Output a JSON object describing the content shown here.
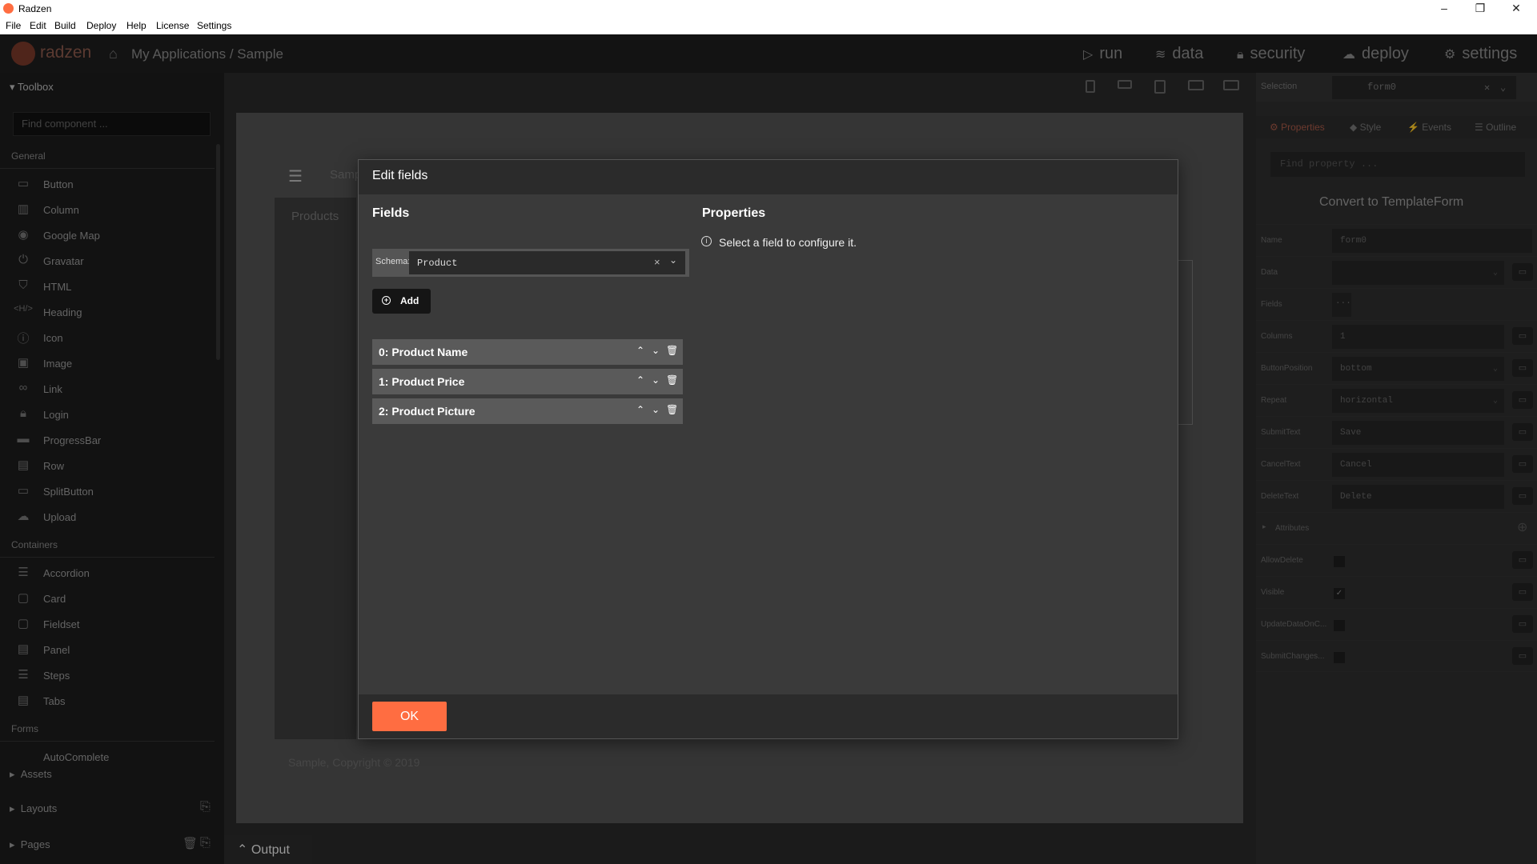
{
  "window": {
    "title": "Radzen",
    "min": "–",
    "max": "❐",
    "close": "✕"
  },
  "menu": [
    "File",
    "Edit",
    "Build",
    "Deploy",
    "Help",
    "License",
    "Settings"
  ],
  "header": {
    "brand": "radzen",
    "breadcrumb": "My Applications / Sample",
    "nav": [
      {
        "icon": "play-icon",
        "label": "run"
      },
      {
        "icon": "layers-icon",
        "label": "data"
      },
      {
        "icon": "lock-icon",
        "label": "security"
      },
      {
        "icon": "cloud-upload-icon",
        "label": "deploy"
      },
      {
        "icon": "gear-icon",
        "label": "settings"
      }
    ]
  },
  "toolbox": {
    "title": "Toolbox",
    "search_placeholder": "Find component ...",
    "general_label": "General",
    "general": [
      "Button",
      "Column",
      "Google Map",
      "Gravatar",
      "HTML",
      "Heading",
      "Icon",
      "Image",
      "Link",
      "Login",
      "ProgressBar",
      "Row",
      "SplitButton",
      "Upload"
    ],
    "containers_label": "Containers",
    "containers": [
      "Accordion",
      "Card",
      "Fieldset",
      "Panel",
      "Steps",
      "Tabs"
    ],
    "forms_label": "Forms",
    "forms_partial": "AutoComplete",
    "assets": "Assets",
    "layouts": "Layouts",
    "pages": "Pages"
  },
  "canvas": {
    "page_title": "Samp",
    "nav_item": "Products",
    "footer": "Sample, Copyright © 2019"
  },
  "props": {
    "selection_label": "Selection",
    "selection_value": "form0",
    "tabs": [
      "Properties",
      "Style",
      "Events",
      "Outline"
    ],
    "find_placeholder": "Find property ...",
    "convert": "Convert to TemplateForm",
    "rows": [
      {
        "label": "Name",
        "value": "form0"
      },
      {
        "label": "Data",
        "value": ""
      },
      {
        "label": "Fields",
        "value": "..."
      },
      {
        "label": "Columns",
        "value": "1"
      },
      {
        "label": "ButtonPosition",
        "value": "bottom"
      },
      {
        "label": "Repeat",
        "value": "horizontal"
      },
      {
        "label": "SubmitText",
        "value": "Save"
      },
      {
        "label": "CancelText",
        "value": "Cancel"
      },
      {
        "label": "DeleteText",
        "value": "Delete"
      },
      {
        "label": "Attributes",
        "value": ""
      },
      {
        "label": "AllowDelete",
        "value": ""
      },
      {
        "label": "Visible",
        "value": "✓"
      },
      {
        "label": "UpdateDataOnC...",
        "value": ""
      },
      {
        "label": "SubmitChanges...",
        "value": ""
      }
    ]
  },
  "dialog": {
    "title": "Edit fields",
    "fields_heading": "Fields",
    "properties_heading": "Properties",
    "info": "Select a field to configure it.",
    "schema_label": "Schema:",
    "schema_value": "Product",
    "add_label": "Add",
    "fields": [
      "0: Product Name",
      "1: Product Price",
      "2: Product Picture"
    ],
    "ok_label": "OK"
  },
  "output": {
    "label": "Output"
  },
  "colors": {
    "accent": "#ff6d41",
    "dark": "#1c1c1c",
    "panel": "#3a3a3a"
  }
}
